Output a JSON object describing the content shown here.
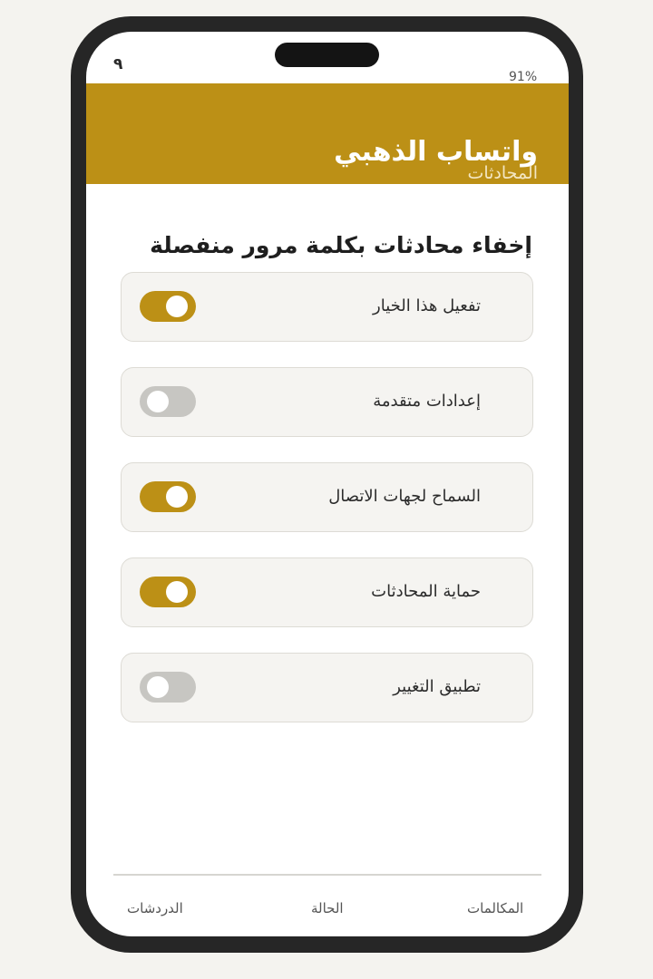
{
  "status_bar": {
    "left_text": "٩",
    "battery": "91%"
  },
  "header": {
    "title": "واتساب الذهبي",
    "subtitle": "المحادثات"
  },
  "section": {
    "title": "إخفاء محادثات بكلمة مرور منفصلة"
  },
  "settings": [
    {
      "label": "تفعيل هذا الخيار",
      "enabled": true
    },
    {
      "label": "إعدادات متقدمة",
      "enabled": false
    },
    {
      "label": "السماح لجهات الاتصال",
      "enabled": true
    },
    {
      "label": "حماية المحادثات",
      "enabled": true
    },
    {
      "label": "تطبيق التغيير",
      "enabled": false
    }
  ],
  "bottom_nav": {
    "chats": "الدردشات",
    "status": "الحالة",
    "calls": "المكالمات"
  },
  "colors": {
    "accent": "#bc9016",
    "toggle_off": "#c7c6c2",
    "frame": "#262626"
  }
}
